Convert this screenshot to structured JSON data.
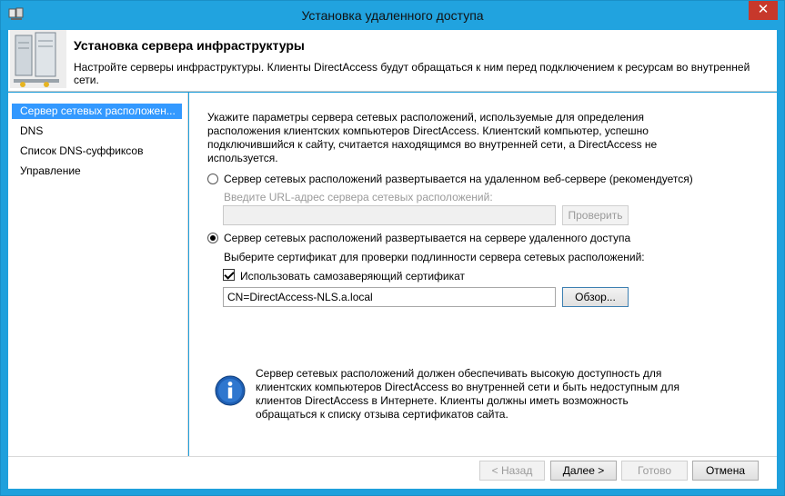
{
  "window": {
    "title": "Установка удаленного доступа",
    "close_label": "✕"
  },
  "header": {
    "title": "Установка сервера инфраструктуры",
    "description": "Настройте серверы инфраструктуры. Клиенты DirectAccess будут обращаться к ним перед подключением к ресурсам во внутренней сети."
  },
  "nav": {
    "items": [
      {
        "label": "Сервер сетевых расположен...",
        "active": true
      },
      {
        "label": "DNS",
        "active": false
      },
      {
        "label": "Список DNS-суффиксов",
        "active": false
      },
      {
        "label": "Управление",
        "active": false
      }
    ]
  },
  "content": {
    "intro": "Укажите параметры сервера сетевых расположений, используемые для определения расположения клиентских компьютеров DirectAccess. Клиентский компьютер, успешно подключившийся к сайту, считается находящимся во внутренней сети, а DirectAccess не используется.",
    "option_remote": {
      "label": "Сервер сетевых расположений развертывается на удаленном веб-сервере (рекомендуется)",
      "checked": false,
      "url_label": "Введите URL-адрес сервера сетевых расположений:",
      "url_value": "",
      "check_button": "Проверить"
    },
    "option_local": {
      "label": "Сервер сетевых расположений развертывается на сервере удаленного доступа",
      "checked": true,
      "cert_label": "Выберите сертификат для проверки подлинности сервера сетевых расположений:",
      "self_signed_label": "Использовать самозаверяющий сертификат",
      "self_signed_checked": true,
      "cert_value": "CN=DirectAccess-NLS.a.local",
      "browse_button": "Обзор..."
    },
    "info_text": "Сервер сетевых расположений должен обеспечивать высокую доступность для клиентских компьютеров DirectAccess во внутренней сети и быть недоступным для клиентов DirectAccess в Интернете. Клиенты должны иметь возможность обращаться к списку отзыва сертификатов сайта."
  },
  "footer": {
    "back": "< Назад",
    "next": "Далее >",
    "finish": "Готово",
    "cancel": "Отмена"
  },
  "colors": {
    "title_bar": "#21a3df",
    "close_button": "#c7382b",
    "nav_selected": "#3399ff"
  }
}
